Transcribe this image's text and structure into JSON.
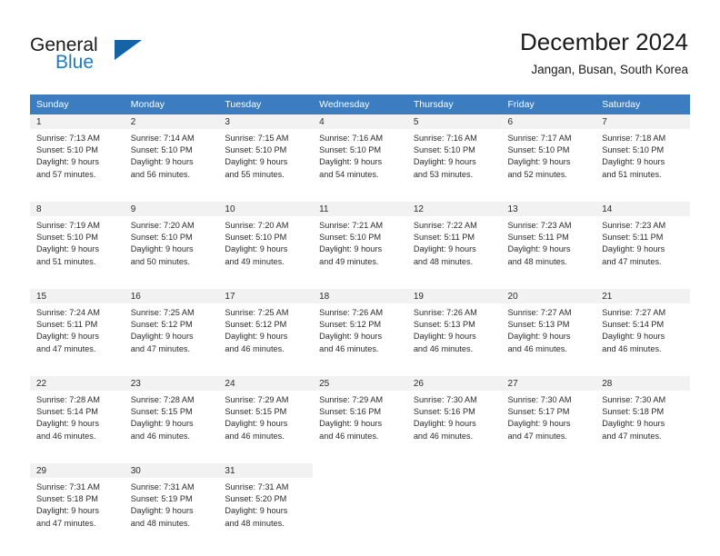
{
  "brand": {
    "name_part1": "General",
    "name_part2": "Blue",
    "logo_icon": "triangle-logo-icon"
  },
  "header": {
    "title": "December 2024",
    "location": "Jangan, Busan, South Korea"
  },
  "colors": {
    "header_row_bg": "#3b7dc0",
    "header_row_text": "#ffffff",
    "daynum_band_bg": "#f2f2f2",
    "brand_blue": "#1f7ac4",
    "logo_blue": "#1464a5",
    "body_text": "#2b2b2b"
  },
  "weekday_headers": [
    "Sunday",
    "Monday",
    "Tuesday",
    "Wednesday",
    "Thursday",
    "Friday",
    "Saturday"
  ],
  "weeks": [
    [
      {
        "day": "1",
        "sunrise": "Sunrise: 7:13 AM",
        "sunset": "Sunset: 5:10 PM",
        "daylight_line1": "Daylight: 9 hours",
        "daylight_line2": "and 57 minutes."
      },
      {
        "day": "2",
        "sunrise": "Sunrise: 7:14 AM",
        "sunset": "Sunset: 5:10 PM",
        "daylight_line1": "Daylight: 9 hours",
        "daylight_line2": "and 56 minutes."
      },
      {
        "day": "3",
        "sunrise": "Sunrise: 7:15 AM",
        "sunset": "Sunset: 5:10 PM",
        "daylight_line1": "Daylight: 9 hours",
        "daylight_line2": "and 55 minutes."
      },
      {
        "day": "4",
        "sunrise": "Sunrise: 7:16 AM",
        "sunset": "Sunset: 5:10 PM",
        "daylight_line1": "Daylight: 9 hours",
        "daylight_line2": "and 54 minutes."
      },
      {
        "day": "5",
        "sunrise": "Sunrise: 7:16 AM",
        "sunset": "Sunset: 5:10 PM",
        "daylight_line1": "Daylight: 9 hours",
        "daylight_line2": "and 53 minutes."
      },
      {
        "day": "6",
        "sunrise": "Sunrise: 7:17 AM",
        "sunset": "Sunset: 5:10 PM",
        "daylight_line1": "Daylight: 9 hours",
        "daylight_line2": "and 52 minutes."
      },
      {
        "day": "7",
        "sunrise": "Sunrise: 7:18 AM",
        "sunset": "Sunset: 5:10 PM",
        "daylight_line1": "Daylight: 9 hours",
        "daylight_line2": "and 51 minutes."
      }
    ],
    [
      {
        "day": "8",
        "sunrise": "Sunrise: 7:19 AM",
        "sunset": "Sunset: 5:10 PM",
        "daylight_line1": "Daylight: 9 hours",
        "daylight_line2": "and 51 minutes."
      },
      {
        "day": "9",
        "sunrise": "Sunrise: 7:20 AM",
        "sunset": "Sunset: 5:10 PM",
        "daylight_line1": "Daylight: 9 hours",
        "daylight_line2": "and 50 minutes."
      },
      {
        "day": "10",
        "sunrise": "Sunrise: 7:20 AM",
        "sunset": "Sunset: 5:10 PM",
        "daylight_line1": "Daylight: 9 hours",
        "daylight_line2": "and 49 minutes."
      },
      {
        "day": "11",
        "sunrise": "Sunrise: 7:21 AM",
        "sunset": "Sunset: 5:10 PM",
        "daylight_line1": "Daylight: 9 hours",
        "daylight_line2": "and 49 minutes."
      },
      {
        "day": "12",
        "sunrise": "Sunrise: 7:22 AM",
        "sunset": "Sunset: 5:11 PM",
        "daylight_line1": "Daylight: 9 hours",
        "daylight_line2": "and 48 minutes."
      },
      {
        "day": "13",
        "sunrise": "Sunrise: 7:23 AM",
        "sunset": "Sunset: 5:11 PM",
        "daylight_line1": "Daylight: 9 hours",
        "daylight_line2": "and 48 minutes."
      },
      {
        "day": "14",
        "sunrise": "Sunrise: 7:23 AM",
        "sunset": "Sunset: 5:11 PM",
        "daylight_line1": "Daylight: 9 hours",
        "daylight_line2": "and 47 minutes."
      }
    ],
    [
      {
        "day": "15",
        "sunrise": "Sunrise: 7:24 AM",
        "sunset": "Sunset: 5:11 PM",
        "daylight_line1": "Daylight: 9 hours",
        "daylight_line2": "and 47 minutes."
      },
      {
        "day": "16",
        "sunrise": "Sunrise: 7:25 AM",
        "sunset": "Sunset: 5:12 PM",
        "daylight_line1": "Daylight: 9 hours",
        "daylight_line2": "and 47 minutes."
      },
      {
        "day": "17",
        "sunrise": "Sunrise: 7:25 AM",
        "sunset": "Sunset: 5:12 PM",
        "daylight_line1": "Daylight: 9 hours",
        "daylight_line2": "and 46 minutes."
      },
      {
        "day": "18",
        "sunrise": "Sunrise: 7:26 AM",
        "sunset": "Sunset: 5:12 PM",
        "daylight_line1": "Daylight: 9 hours",
        "daylight_line2": "and 46 minutes."
      },
      {
        "day": "19",
        "sunrise": "Sunrise: 7:26 AM",
        "sunset": "Sunset: 5:13 PM",
        "daylight_line1": "Daylight: 9 hours",
        "daylight_line2": "and 46 minutes."
      },
      {
        "day": "20",
        "sunrise": "Sunrise: 7:27 AM",
        "sunset": "Sunset: 5:13 PM",
        "daylight_line1": "Daylight: 9 hours",
        "daylight_line2": "and 46 minutes."
      },
      {
        "day": "21",
        "sunrise": "Sunrise: 7:27 AM",
        "sunset": "Sunset: 5:14 PM",
        "daylight_line1": "Daylight: 9 hours",
        "daylight_line2": "and 46 minutes."
      }
    ],
    [
      {
        "day": "22",
        "sunrise": "Sunrise: 7:28 AM",
        "sunset": "Sunset: 5:14 PM",
        "daylight_line1": "Daylight: 9 hours",
        "daylight_line2": "and 46 minutes."
      },
      {
        "day": "23",
        "sunrise": "Sunrise: 7:28 AM",
        "sunset": "Sunset: 5:15 PM",
        "daylight_line1": "Daylight: 9 hours",
        "daylight_line2": "and 46 minutes."
      },
      {
        "day": "24",
        "sunrise": "Sunrise: 7:29 AM",
        "sunset": "Sunset: 5:15 PM",
        "daylight_line1": "Daylight: 9 hours",
        "daylight_line2": "and 46 minutes."
      },
      {
        "day": "25",
        "sunrise": "Sunrise: 7:29 AM",
        "sunset": "Sunset: 5:16 PM",
        "daylight_line1": "Daylight: 9 hours",
        "daylight_line2": "and 46 minutes."
      },
      {
        "day": "26",
        "sunrise": "Sunrise: 7:30 AM",
        "sunset": "Sunset: 5:16 PM",
        "daylight_line1": "Daylight: 9 hours",
        "daylight_line2": "and 46 minutes."
      },
      {
        "day": "27",
        "sunrise": "Sunrise: 7:30 AM",
        "sunset": "Sunset: 5:17 PM",
        "daylight_line1": "Daylight: 9 hours",
        "daylight_line2": "and 47 minutes."
      },
      {
        "day": "28",
        "sunrise": "Sunrise: 7:30 AM",
        "sunset": "Sunset: 5:18 PM",
        "daylight_line1": "Daylight: 9 hours",
        "daylight_line2": "and 47 minutes."
      }
    ],
    [
      {
        "day": "29",
        "sunrise": "Sunrise: 7:31 AM",
        "sunset": "Sunset: 5:18 PM",
        "daylight_line1": "Daylight: 9 hours",
        "daylight_line2": "and 47 minutes."
      },
      {
        "day": "30",
        "sunrise": "Sunrise: 7:31 AM",
        "sunset": "Sunset: 5:19 PM",
        "daylight_line1": "Daylight: 9 hours",
        "daylight_line2": "and 48 minutes."
      },
      {
        "day": "31",
        "sunrise": "Sunrise: 7:31 AM",
        "sunset": "Sunset: 5:20 PM",
        "daylight_line1": "Daylight: 9 hours",
        "daylight_line2": "and 48 minutes."
      },
      {
        "day": "",
        "sunrise": "",
        "sunset": "",
        "daylight_line1": "",
        "daylight_line2": ""
      },
      {
        "day": "",
        "sunrise": "",
        "sunset": "",
        "daylight_line1": "",
        "daylight_line2": ""
      },
      {
        "day": "",
        "sunrise": "",
        "sunset": "",
        "daylight_line1": "",
        "daylight_line2": ""
      },
      {
        "day": "",
        "sunrise": "",
        "sunset": "",
        "daylight_line1": "",
        "daylight_line2": ""
      }
    ]
  ]
}
